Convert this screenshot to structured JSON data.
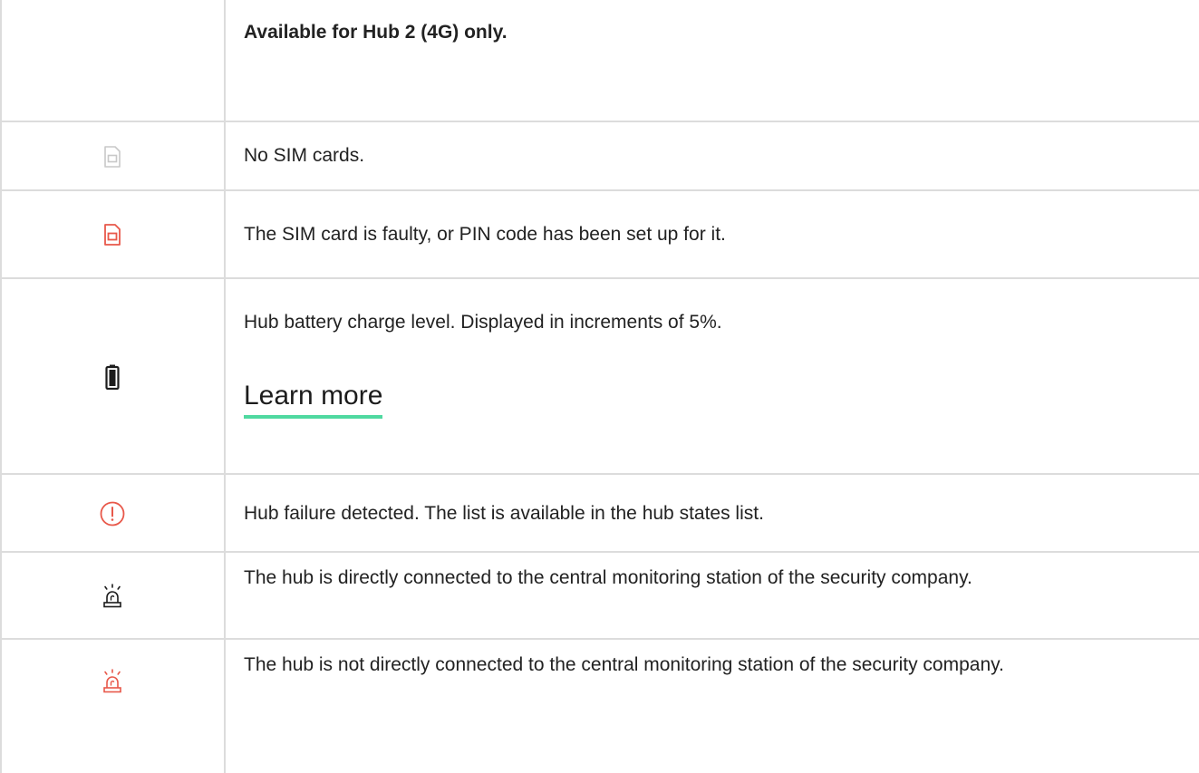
{
  "rows": [
    {
      "icon": "",
      "text": "Available for Hub 2 (4G) only."
    },
    {
      "icon": "sim-card-empty-icon",
      "text": "No SIM cards."
    },
    {
      "icon": "sim-card-faulty-icon",
      "text": "The SIM card is faulty, or PIN code has been set up for it."
    },
    {
      "icon": "battery-icon",
      "text": "Hub battery charge level. Displayed in increments of 5%.",
      "link": "Learn more"
    },
    {
      "icon": "failure-exclamation-icon",
      "text": "Hub failure detected. The list is available in the hub states list."
    },
    {
      "icon": "siren-connected-icon",
      "text": "The hub is directly connected to the central monitoring station of the security company."
    },
    {
      "icon": "siren-disconnected-icon",
      "text": "The hub is not directly connected to the central monitoring station of the security company."
    }
  ],
  "colors": {
    "border": "#dcdcdc",
    "icon_gray": "#c8c8c8",
    "icon_red": "#e8584a",
    "icon_dark": "#1c1c1c",
    "link_underline": "#4fd9a0"
  }
}
